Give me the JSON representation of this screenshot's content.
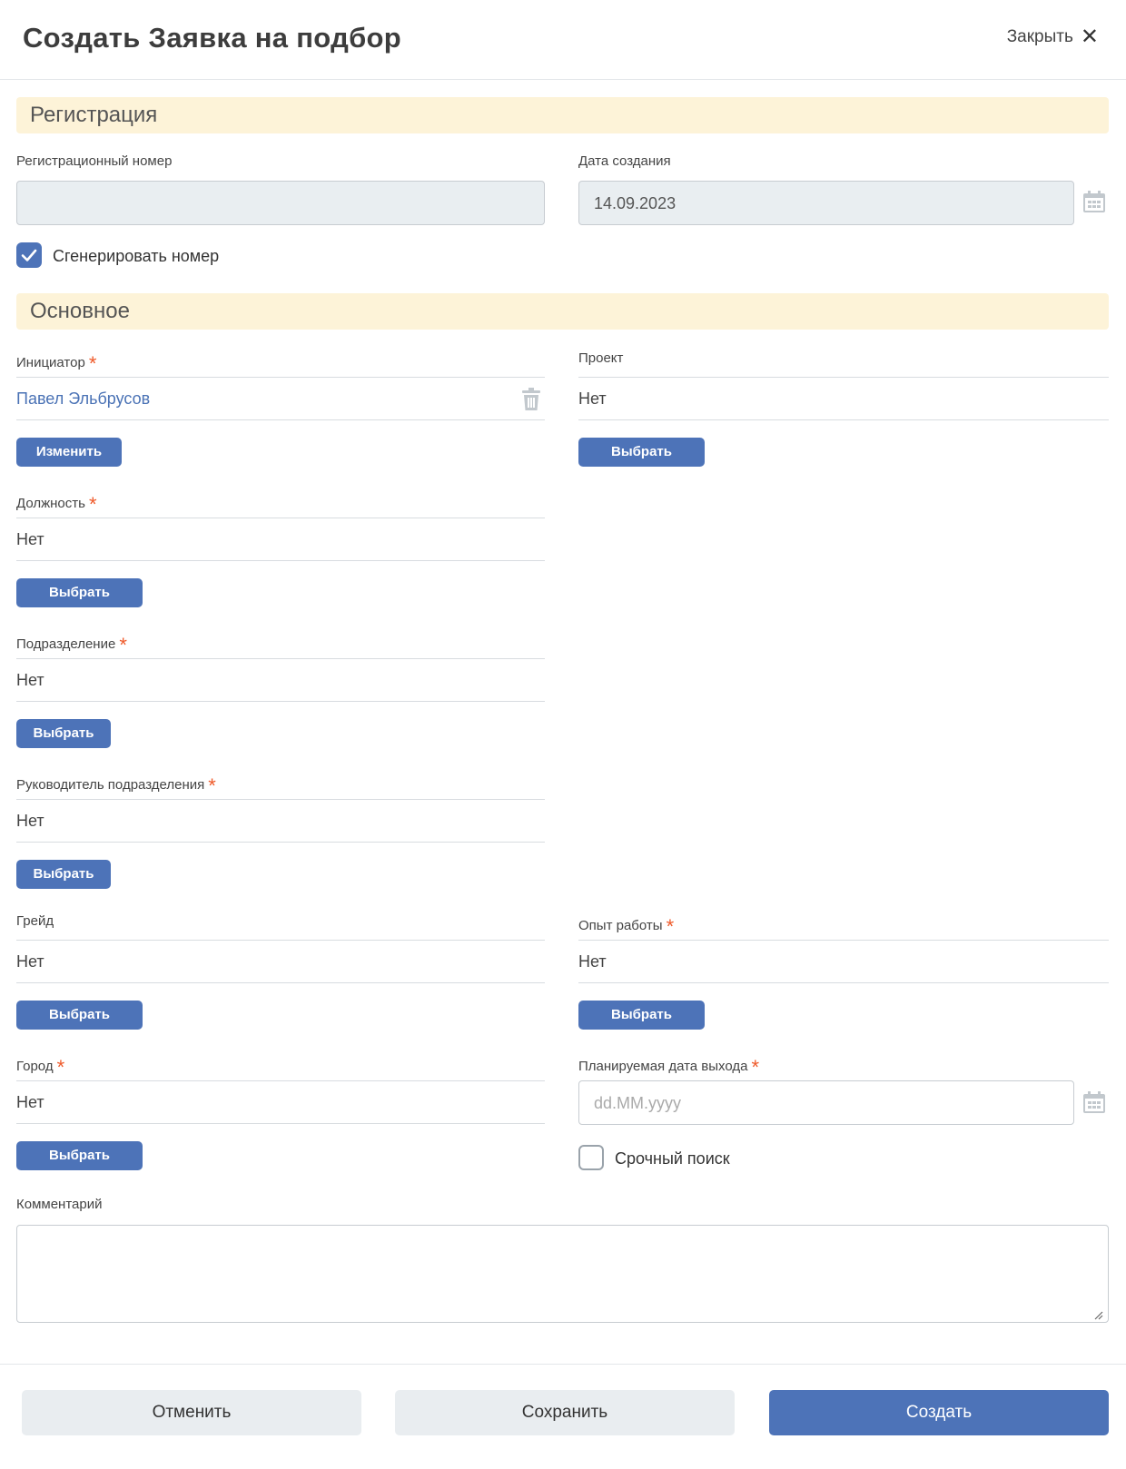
{
  "header": {
    "title": "Создать Заявка на подбор",
    "close_label": "Закрыть"
  },
  "sections": {
    "registration": "Регистрация",
    "main": "Основное"
  },
  "registration": {
    "reg_number_label": "Регистрационный номер",
    "reg_number_value": "",
    "created_date_label": "Дата создания",
    "created_date_value": "14.09.2023",
    "generate_label": "Сгенерировать номер",
    "generate_checked": true
  },
  "main": {
    "initiator": {
      "label": "Инициатор",
      "value": "Павел Эльбрусов",
      "button": "Изменить"
    },
    "project": {
      "label": "Проект",
      "value": "Нет",
      "button": "Выбрать"
    },
    "position": {
      "label": "Должность",
      "value": "Нет",
      "button": "Выбрать"
    },
    "department": {
      "label": "Подразделение",
      "value": "Нет",
      "button": "Выбрать"
    },
    "manager": {
      "label": "Руководитель подразделения",
      "value": "Нет",
      "button": "Выбрать"
    },
    "grade": {
      "label": "Грейд",
      "value": "Нет",
      "button": "Выбрать"
    },
    "experience": {
      "label": "Опыт работы",
      "value": "Нет",
      "button": "Выбрать"
    },
    "city": {
      "label": "Город",
      "value": "Нет",
      "button": "Выбрать"
    },
    "start_date": {
      "label": "Планируемая дата выхода",
      "placeholder": "dd.MM.yyyy"
    },
    "urgent": {
      "label": "Срочный поиск",
      "checked": false
    },
    "comment": {
      "label": "Комментарий",
      "value": ""
    },
    "required_mark": "*"
  },
  "footer": {
    "cancel": "Отменить",
    "save": "Сохранить",
    "create": "Создать"
  },
  "colors": {
    "accent": "#4d73b8",
    "section_bg": "#fdf3d8",
    "required": "#ef5a2a",
    "link": "#4a72b5"
  }
}
